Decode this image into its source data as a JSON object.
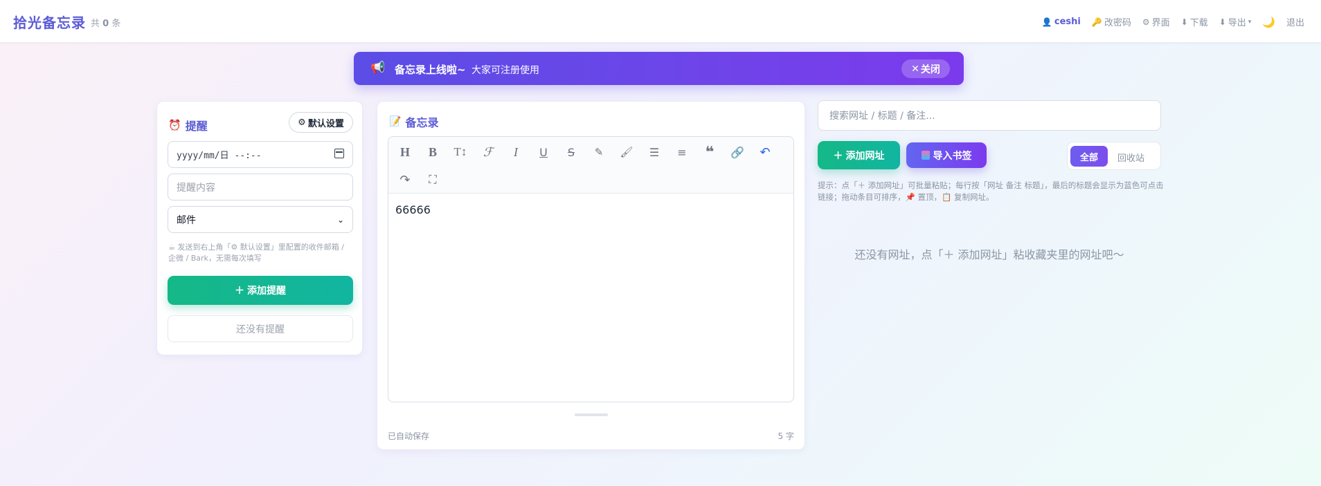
{
  "header": {
    "brand": "拾光备忘录",
    "count_prefix": "共",
    "count_value": "0",
    "count_suffix": "条",
    "user": "ceshi",
    "change_password": "改密码",
    "interface": "界面",
    "download": "下载",
    "export": "导出",
    "logout": "退出"
  },
  "announcement": {
    "title": "备忘录上线啦~",
    "message": "大家可注册使用",
    "close_label": "关闭"
  },
  "reminder": {
    "title": "提醒",
    "default_settings": "默认设置",
    "date_placeholder": "yyyy/mm/日  --:--",
    "content_placeholder": "提醒内容",
    "channel_selected": "邮件",
    "hint": "发送到右上角「⚙ 默认设置」里配置的收件邮箱 / 企微 / Bark，无需每次填写",
    "add_button": "添加提醒",
    "empty_text": "还没有提醒"
  },
  "memo": {
    "title": "备忘录",
    "content": "66666",
    "autosave": "已自动保存",
    "char_count": "5 字"
  },
  "urls": {
    "search_placeholder": "搜索网址 / 标题 / 备注...",
    "add_button": "添加网址",
    "import_button": "导入书签",
    "filter_all": "全部",
    "filter_recycle": "回收站",
    "tip": "提示：点「＋ 添加网址」可批量粘贴；每行按「网址 备注 标题」，最后的标题会显示为蓝色可点击链接；拖动条目可排序，📌 置顶，📋 复制网址。",
    "empty_text": "还没有网址，点「＋ 添加网址」粘收藏夹里的网址吧～"
  },
  "colors": {
    "brand": "#5b5bd6",
    "green": "#15b886",
    "purple": "#7c3aed"
  }
}
